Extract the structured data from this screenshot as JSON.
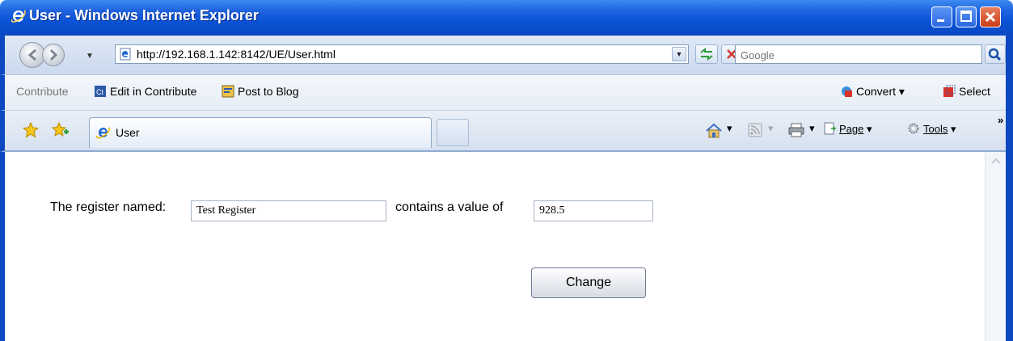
{
  "window": {
    "title": "User - Windows Internet Explorer"
  },
  "address_bar": {
    "url": "http://192.168.1.142:8142/UE/User.html",
    "search_placeholder": "Google"
  },
  "links_toolbar": {
    "contribute_label": "Contribute",
    "edit_in_contribute_label": "Edit in Contribute",
    "post_to_blog_label": "Post to Blog",
    "convert_label": "Convert",
    "select_label": "Select"
  },
  "tabs": [
    {
      "label": "User"
    }
  ],
  "command_bar": {
    "page_label": "Page",
    "tools_label": "Tools",
    "more_label": "»"
  },
  "form": {
    "register_label": "The register named:",
    "register_name_value": "Test Register",
    "contains_label": "contains a value of",
    "register_value": "928.5",
    "change_button_label": "Change"
  },
  "colors": {
    "frame_blue": "#0b48c2",
    "title_text": "#ffffff",
    "close_red": "#c83d16"
  }
}
